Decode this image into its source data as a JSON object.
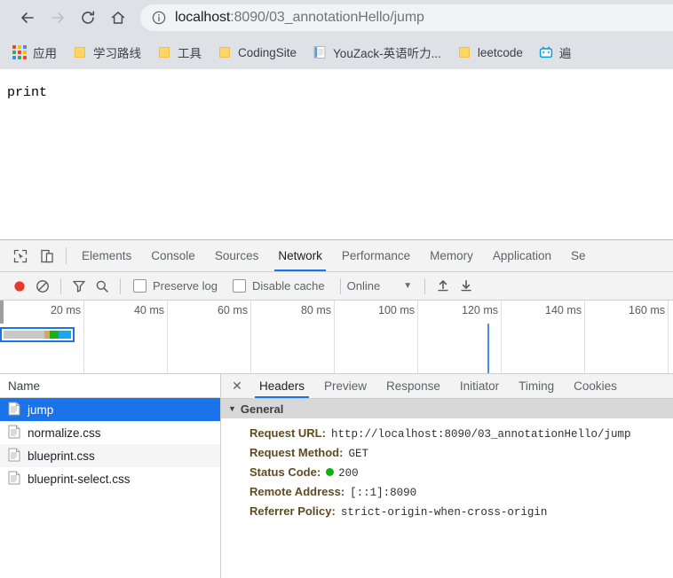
{
  "browser": {
    "nav": {
      "back": "back-arrow",
      "forward": "forward-arrow",
      "reload": "reload-icon",
      "home": "home-icon"
    },
    "omnibox": {
      "info_icon": "info-circle-icon",
      "host": "localhost",
      "path": ":8090/03_annotationHello/jump"
    },
    "bookmarks": [
      {
        "label": "应用",
        "icon": "apps-grid-icon"
      },
      {
        "label": "学习路线",
        "icon": "folder-icon"
      },
      {
        "label": "工具",
        "icon": "folder-icon"
      },
      {
        "label": "CodingSite",
        "icon": "folder-icon"
      },
      {
        "label": "YouZack-英语听力...",
        "icon": "page-icon"
      },
      {
        "label": "leetcode",
        "icon": "folder-icon"
      },
      {
        "label": "遍",
        "icon": "bilibili-icon"
      }
    ]
  },
  "page": {
    "body_text": "print"
  },
  "devtools": {
    "tools": [
      "inspect-element-icon",
      "device-toolbar-icon"
    ],
    "tabs": [
      {
        "label": "Elements",
        "active": false
      },
      {
        "label": "Console",
        "active": false
      },
      {
        "label": "Sources",
        "active": false
      },
      {
        "label": "Network",
        "active": true
      },
      {
        "label": "Performance",
        "active": false
      },
      {
        "label": "Memory",
        "active": false
      },
      {
        "label": "Application",
        "active": false
      },
      {
        "label": "Se",
        "active": false
      }
    ],
    "network_toolbar": {
      "record_icon": "record-button",
      "clear_icon": "clear-icon",
      "filter_icon": "filter-funnel-icon",
      "search_icon": "search-icon",
      "preserve_log": {
        "label": "Preserve log",
        "checked": false
      },
      "disable_cache": {
        "label": "Disable cache",
        "checked": false
      },
      "throttling": {
        "value": "Online"
      },
      "import_icon": "import-har-icon",
      "export_icon": "export-har-icon"
    },
    "overview": {
      "ticks": [
        "20 ms",
        "40 ms",
        "60 ms",
        "80 ms",
        "100 ms",
        "120 ms",
        "140 ms",
        "160 ms"
      ],
      "marker_label": "120 ms",
      "selection_segments": [
        "#c8c8c8",
        "#c9ab7a",
        "#f0a030",
        "#18b018",
        "#19a8f0"
      ]
    },
    "requests": {
      "column_header": "Name",
      "rows": [
        {
          "name": "jump",
          "icon": "document-icon",
          "selected": true
        },
        {
          "name": "normalize.css",
          "icon": "document-icon",
          "selected": false
        },
        {
          "name": "blueprint.css",
          "icon": "document-icon",
          "selected": false
        },
        {
          "name": "blueprint-select.css",
          "icon": "document-icon",
          "selected": false
        }
      ]
    },
    "detail": {
      "close_icon": "close-icon",
      "tabs": [
        {
          "label": "Headers",
          "active": true
        },
        {
          "label": "Preview",
          "active": false
        },
        {
          "label": "Response",
          "active": false
        },
        {
          "label": "Initiator",
          "active": false
        },
        {
          "label": "Timing",
          "active": false
        },
        {
          "label": "Cookies",
          "active": false
        }
      ],
      "general": {
        "section_title": "General",
        "rows": [
          {
            "key": "Request URL:",
            "value": "http://localhost:8090/03_annotationHello/jump",
            "dot": false
          },
          {
            "key": "Request Method:",
            "value": "GET",
            "dot": false
          },
          {
            "key": "Status Code:",
            "value": "200",
            "dot": true
          },
          {
            "key": "Remote Address:",
            "value": "[::1]:8090",
            "dot": false
          },
          {
            "key": "Referrer Policy:",
            "value": "strict-origin-when-cross-origin",
            "dot": false
          }
        ]
      }
    }
  },
  "colors": {
    "accent": "#1a73e8",
    "chrome_bg": "#dee1e6",
    "record_red": "#e8392e",
    "status_green": "#10b010"
  }
}
